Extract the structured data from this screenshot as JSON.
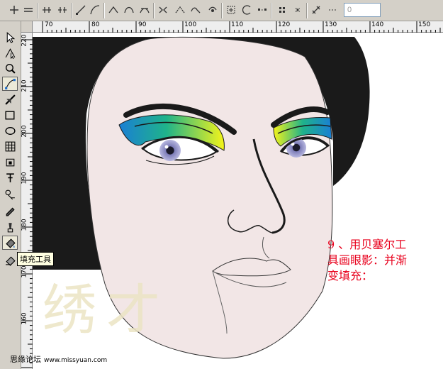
{
  "toolbar": {
    "buttons": [
      "add-node-icon",
      "delete-node-icon",
      "join-nodes-icon",
      "break-curve-icon",
      "to-line-icon",
      "to-curve-icon",
      "cusp-node-icon",
      "smooth-node-icon",
      "symmetrical-node-icon",
      "reverse-direction-icon",
      "extend-curve-icon",
      "extract-subpath-icon",
      "stretch-nodes-icon",
      "rotate-nodes-icon",
      "align-nodes-icon",
      "reflect-horizontal-icon",
      "reflect-vertical-icon",
      "elastic-mode-icon",
      "select-all-nodes-icon"
    ],
    "curve_smoothness_value": "0"
  },
  "toolbox": {
    "tools": [
      "pick-tool-icon",
      "shape-tool-icon",
      "zoom-tool-icon",
      "freehand-tool-icon",
      "smart-fill-tool-icon",
      "rectangle-tool-icon",
      "ellipse-tool-icon",
      "polygon-tool-icon",
      "basic-shapes-tool-icon",
      "text-tool-icon",
      "interactive-blend-tool-icon",
      "eyedropper-tool-icon",
      "outline-tool-icon",
      "fill-tool-icon",
      "interactive-fill-tool-icon"
    ],
    "active_tool": "fill-tool-icon"
  },
  "ruler": {
    "top_labels": [
      "70",
      "80",
      "90",
      "100",
      "110",
      "120",
      "130",
      "140",
      "150"
    ],
    "left_labels": [
      "220",
      "210",
      "200",
      "190",
      "180",
      "170",
      "160"
    ]
  },
  "tooltip": {
    "text": "填充工具"
  },
  "note": {
    "line1": "9 、用贝塞尔工",
    "line2": "具画眼影：并渐",
    "line3": "变填充："
  },
  "watermark": {
    "text": "绣才"
  },
  "footer": {
    "site_name": "思缘论坛",
    "site_url": "www.missyuan.com"
  },
  "colors": {
    "hair": "#1a1a1a",
    "skin": "#f2e6e6",
    "eyeshadow_blue": "#1a7fd4",
    "eyeshadow_green": "#1fb38a",
    "eyeshadow_yellow": "#f4f41a",
    "iris": "#8e8ec8",
    "note_text": "#e8001c",
    "ui_gray": "#d4d0c8"
  }
}
